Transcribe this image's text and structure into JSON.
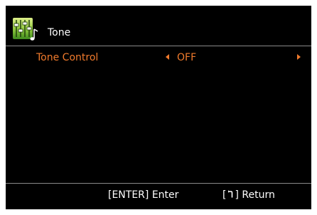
{
  "header": {
    "title": "Tone",
    "icon": "equalizer-sliders-note-icon"
  },
  "menu": {
    "items": [
      {
        "label": "Tone Control",
        "value": "OFF",
        "selected": true
      }
    ]
  },
  "footer": {
    "enter_hint": "[ENTER] Enter",
    "return_open": "[",
    "return_close": "] Return",
    "return_icon": "return-arrow-icon"
  },
  "colors": {
    "background": "#000000",
    "border": "#ffffff",
    "highlight": "#f07a2c",
    "text": "#ffffff",
    "divider": "#8a8a8a"
  }
}
